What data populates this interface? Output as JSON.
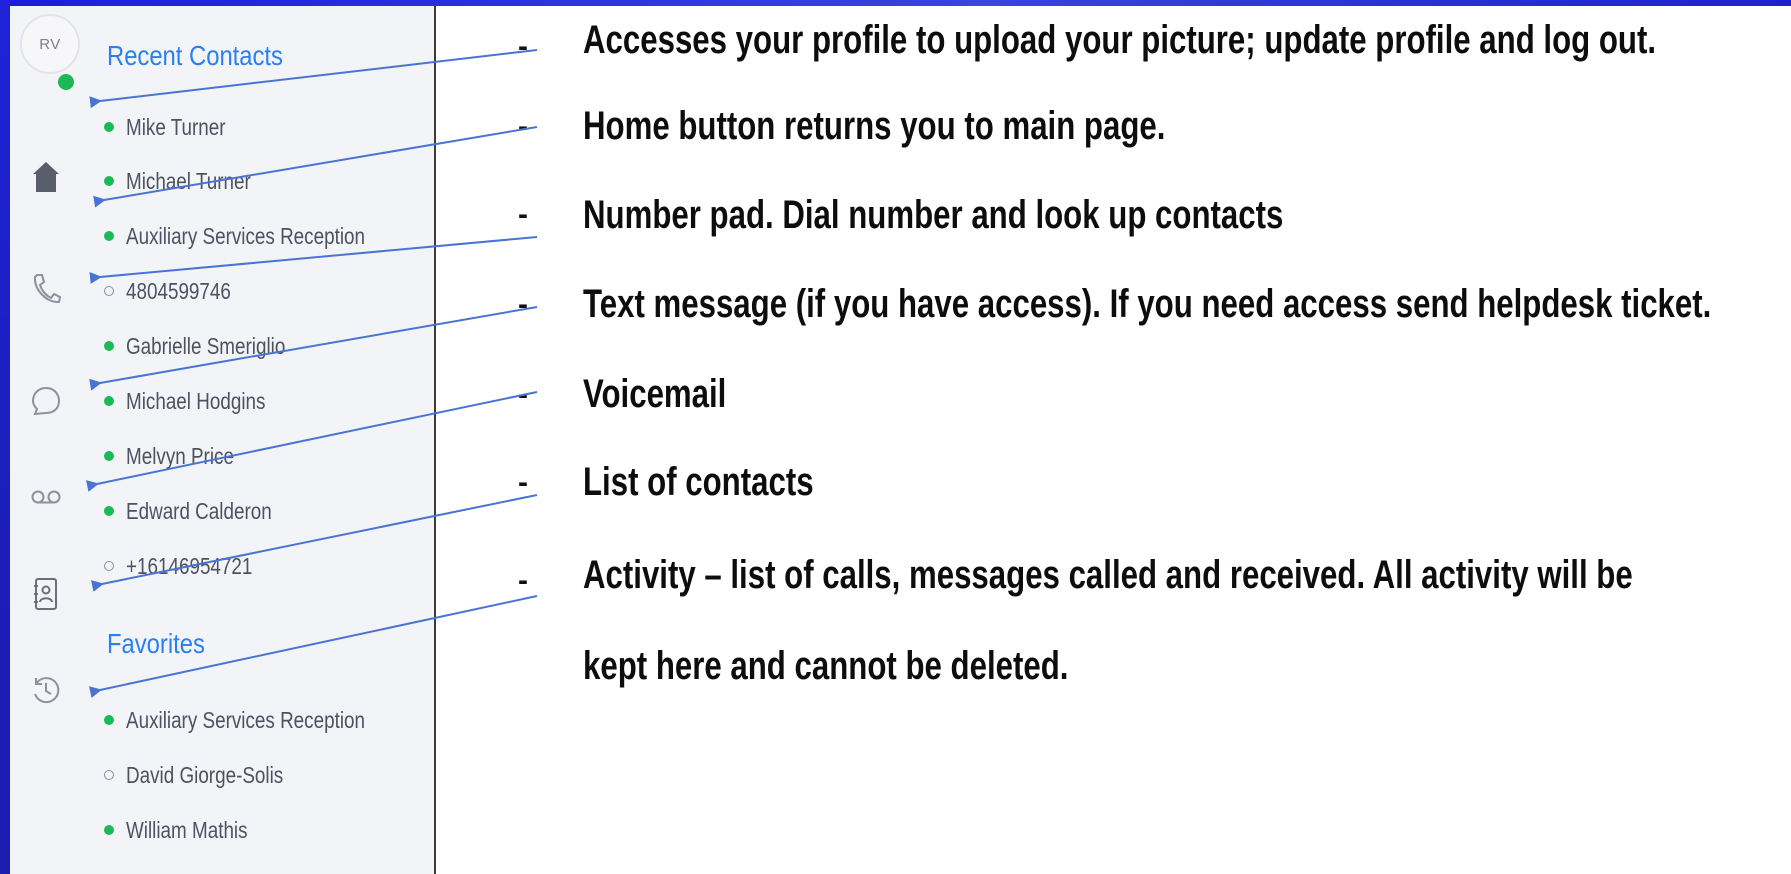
{
  "sidebar": {
    "avatar_initials": "RV",
    "avatar_status": "online",
    "rail_icons": [
      {
        "name": "home-icon"
      },
      {
        "name": "phone-icon"
      },
      {
        "name": "chat-icon"
      },
      {
        "name": "voicemail-icon"
      },
      {
        "name": "contacts-book-icon"
      },
      {
        "name": "activity-history-icon"
      }
    ]
  },
  "recent_contacts": {
    "title": "Recent Contacts",
    "items": [
      {
        "name": "Mike Turner",
        "status": "online"
      },
      {
        "name": "Michael Turner",
        "status": "online"
      },
      {
        "name": "Auxiliary Services Reception",
        "status": "online"
      },
      {
        "name": "4804599746",
        "status": "offline"
      },
      {
        "name": "Gabrielle Smeriglio",
        "status": "online"
      },
      {
        "name": "Michael Hodgins",
        "status": "online"
      },
      {
        "name": "Melvyn Price",
        "status": "online"
      },
      {
        "name": "Edward Calderon",
        "status": "online"
      },
      {
        "name": "+16146954721",
        "status": "offline"
      }
    ]
  },
  "favorites": {
    "title": "Favorites",
    "items": [
      {
        "name": "Auxiliary Services Reception",
        "status": "online"
      },
      {
        "name": "David Giorge-Solis",
        "status": "offline"
      },
      {
        "name": "William Mathis",
        "status": "online"
      }
    ]
  },
  "descriptions": [
    {
      "dash": "-",
      "text": "Accesses your profile to upload your picture; update profile and log out."
    },
    {
      "dash": "-",
      "text": "Home button returns you to main page."
    },
    {
      "dash": "-",
      "text": "Number pad. Dial number and look up contacts"
    },
    {
      "dash": "-",
      "text": "Text message (if you have access). If you need access send helpdesk ticket."
    },
    {
      "dash": "-",
      "text": "Voicemail"
    },
    {
      "dash": "-",
      "text": "List of contacts"
    },
    {
      "dash": "-",
      "text": "Activity – list of calls, messages called and received. All activity will be"
    },
    {
      "dash": "",
      "text": "kept here and cannot be deleted."
    }
  ],
  "colors": {
    "accent": "#2a7ff2",
    "online": "#1cba57",
    "arrow": "#4a74d4",
    "frame": "#1f22d8"
  }
}
